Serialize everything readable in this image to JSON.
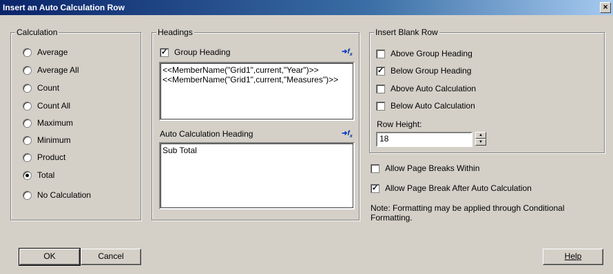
{
  "window": {
    "title": "Insert an Auto Calculation Row",
    "close_label": "×"
  },
  "calculation": {
    "label": "Calculation",
    "options": [
      {
        "label": "Average",
        "selected": false
      },
      {
        "label": "Average All",
        "selected": false
      },
      {
        "label": "Count",
        "selected": false
      },
      {
        "label": "Count All",
        "selected": false
      },
      {
        "label": "Maximum",
        "selected": false
      },
      {
        "label": "Minimum",
        "selected": false
      },
      {
        "label": "Product",
        "selected": false
      },
      {
        "label": "Total",
        "selected": true
      },
      {
        "label": "No Calculation",
        "selected": false
      }
    ]
  },
  "headings": {
    "label": "Headings",
    "group_heading": {
      "label": "Group Heading",
      "checked": true,
      "value": "<<MemberName(\"Grid1\",current,\"Year\")>>\n<<MemberName(\"Grid1\",current,\"Measures\")>>"
    },
    "auto_calc_heading": {
      "label": "Auto Calculation Heading",
      "value": "Sub Total"
    },
    "fx_icon": "insert-function-icon"
  },
  "insert_blank_row": {
    "label": "Insert Blank Row",
    "options": [
      {
        "label": "Above Group Heading",
        "checked": false
      },
      {
        "label": "Below Group Heading",
        "checked": true
      },
      {
        "label": "Above Auto Calculation",
        "checked": false
      },
      {
        "label": "Below Auto Calculation",
        "checked": false
      }
    ],
    "row_height_label": "Row Height:",
    "row_height_value": "18"
  },
  "page_breaks": {
    "allow_within": {
      "label": "Allow Page Breaks Within",
      "checked": false
    },
    "allow_after": {
      "label": "Allow Page Break After Auto Calculation",
      "checked": true
    }
  },
  "note": "Note: Formatting may be applied through Conditional Formatting.",
  "buttons": {
    "ok": "OK",
    "cancel": "Cancel",
    "help": "Help"
  }
}
